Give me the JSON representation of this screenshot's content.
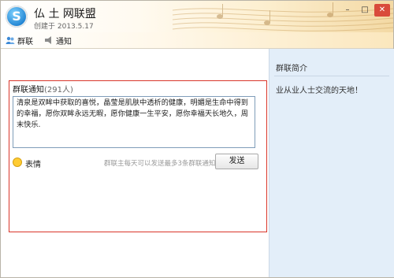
{
  "window": {
    "title": "仏 土 网联盟",
    "subtitle": "创建于 2013.5.17",
    "minimize": "–",
    "maximize": "□",
    "close": "✕"
  },
  "tabs": [
    {
      "label": "群联",
      "icon": "group-icon"
    },
    {
      "label": "通知",
      "icon": "notice-icon"
    }
  ],
  "notice": {
    "title": "群联通知",
    "member_count": "(291人)",
    "text": "清泉是双眸中获取的喜悦，晶莹是肌肤中透析的健康，明媚是生命中得到的幸福，愿你双眸永远无暇，愿你健康一生平安，愿你幸福天长地久，周末快乐.",
    "emoji_label": "表情",
    "hint": "群联主每天可以发送最多3条群联通知",
    "send_label": "发送"
  },
  "side": {
    "title": "群联简介",
    "text": "业从业人士交流的天地！"
  },
  "colors": {
    "highlight_border": "#d9362b",
    "side_bg": "#e3eef9"
  }
}
